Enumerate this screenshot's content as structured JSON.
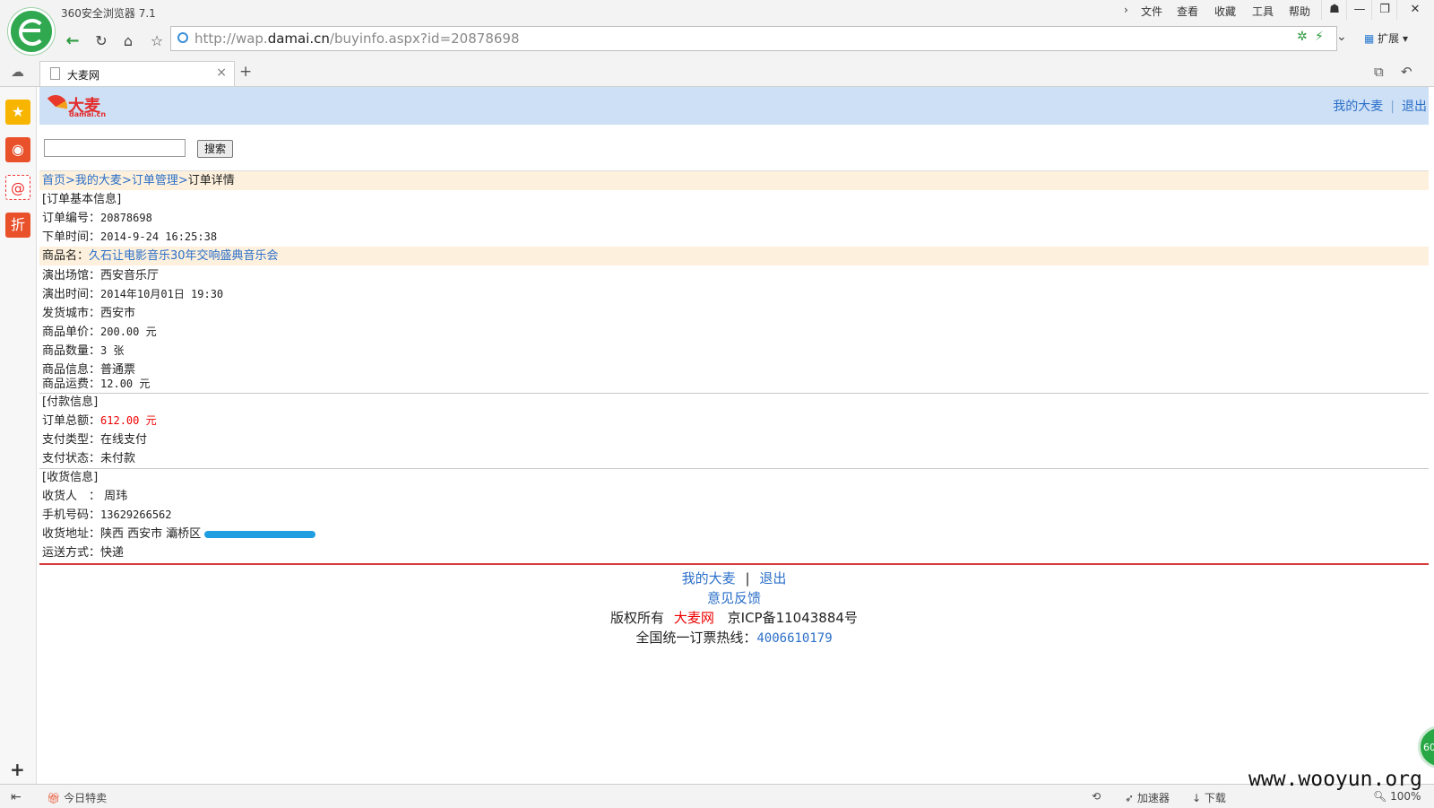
{
  "browser": {
    "title": "360安全浏览器 7.1",
    "menu": [
      "文件",
      "查看",
      "收藏",
      "工具",
      "帮助"
    ],
    "url_prefix": "http://wap.",
    "url_domain": "damai.cn",
    "url_path": "/buyinfo.aspx?id=20878698",
    "extensions_label": "扩展",
    "tab_title": "大麦网",
    "status_left": "今日特卖",
    "status_items": [
      "加速器",
      "下载"
    ],
    "zoom": "100%",
    "float_ball": "60"
  },
  "watermark": "www.wooyun.org",
  "site": {
    "logo_text": "大麦",
    "logo_sub": "damai.cn",
    "header_links": {
      "my": "我的大麦",
      "sep": "|",
      "logout": "退出"
    },
    "search_button": "搜索"
  },
  "breadcrumb": {
    "home": "首页",
    "my": "我的大麦",
    "orders": "订单管理",
    "current": "订单详情",
    "sep": ">"
  },
  "order": {
    "section_basic": "[订单基本信息]",
    "order_no_label": "订单编号：",
    "order_no": "20878698",
    "order_time_label": "下单时间：",
    "order_time": "2014-9-24 16:25:38",
    "product_label": "商品名：",
    "product_name": "久石让电影音乐30年交响盛典音乐会",
    "venue_label": "演出场馆：",
    "venue": "西安音乐厅",
    "show_time_label": "演出时间：",
    "show_time": "2014年10月01日 19:30",
    "city_label": "发货城市：",
    "city": "西安市",
    "price_label": "商品单价：",
    "price": "200.00 元",
    "qty_label": "商品数量：",
    "qty": "3 张",
    "info_label": "商品信息：",
    "info": "普通票",
    "fee_label": "商品运费：",
    "fee": "12.00 元"
  },
  "payment": {
    "section": "[付款信息]",
    "total_label": "订单总额：",
    "total": "612.00 元",
    "type_label": "支付类型：",
    "type": "在线支付",
    "status_label": "支付状态：",
    "status": "未付款"
  },
  "delivery": {
    "section": "[收货信息]",
    "receiver_label": "收货人　：",
    "receiver": "周玮",
    "phone_label": "手机号码：",
    "phone": "13629266562",
    "address_label": "收货地址：",
    "address": "陕西 西安市 灞桥区",
    "method_label": "运送方式：",
    "method": "快递"
  },
  "footer": {
    "my": "我的大麦",
    "sep": "|",
    "logout": "退出",
    "feedback": "意见反馈",
    "copyright_prefix": "版权所有",
    "brand": "大麦网",
    "icp": "京ICP备11043884号",
    "hotline_label": "全国统一订票热线：",
    "hotline": "4006610179"
  }
}
